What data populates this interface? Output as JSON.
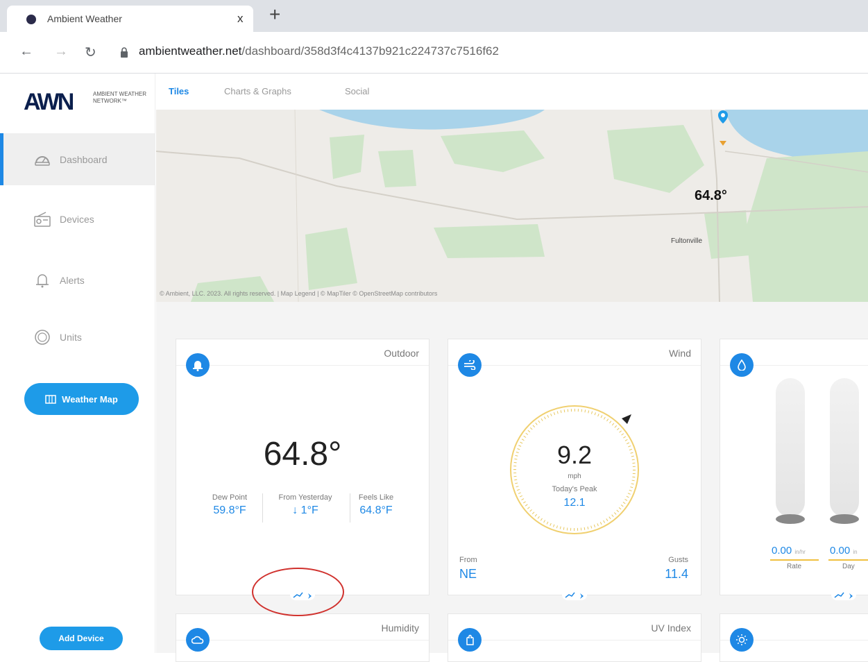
{
  "browser": {
    "tab_title": "Ambient Weather",
    "tab_close": "x",
    "new_tab": "+",
    "url_domain": "ambientweather.net",
    "url_path": "/dashboard/358d3f4c4137b921c224737c7516f62"
  },
  "sidebar": {
    "logo_mark": "AWN",
    "logo_sub": "AMBIENT WEATHER NETWORK™",
    "items": [
      {
        "label": "Dashboard",
        "icon": "dashboard-icon"
      },
      {
        "label": "Devices",
        "icon": "radio-icon"
      },
      {
        "label": "Alerts",
        "icon": "bell-icon"
      },
      {
        "label": "Units",
        "icon": "globe-icon"
      }
    ],
    "weather_map_label": "Weather Map",
    "add_device_label": "Add Device"
  },
  "tabs": [
    {
      "label": "Tiles"
    },
    {
      "label": "Charts & Graphs"
    },
    {
      "label": "Social"
    }
  ],
  "map": {
    "temp": "64.8°",
    "town": "Fultonville",
    "attribution": "© Ambient, LLC. 2023. All rights reserved. | Map Legend | © MapTiler © OpenStreetMap contributors"
  },
  "outdoor": {
    "title": "Outdoor",
    "temp": "64.8°",
    "dewpoint_label": "Dew Point",
    "dewpoint_value": "59.8°F",
    "from_yesterday_label": "From Yesterday",
    "from_yesterday_value": "↓ 1°F",
    "feels_like_label": "Feels Like",
    "feels_like_value": "64.8°F"
  },
  "wind": {
    "title": "Wind",
    "speed": "9.2",
    "unit": "mph",
    "peak_label": "Today's Peak",
    "peak_value": "12.1",
    "from_label": "From",
    "from_value": "NE",
    "gusts_label": "Gusts",
    "gusts_value": "11.4"
  },
  "rain": {
    "rate_value": "0.00",
    "rate_unit": "in/hr",
    "rate_label": "Rate",
    "day_value": "0.00",
    "day_unit": "in",
    "day_label": "Day"
  },
  "row2": {
    "humidity_title": "Humidity",
    "uv_title": "UV Index"
  },
  "colors": {
    "accent": "#1e88e5",
    "annotation": "#d0312d"
  }
}
